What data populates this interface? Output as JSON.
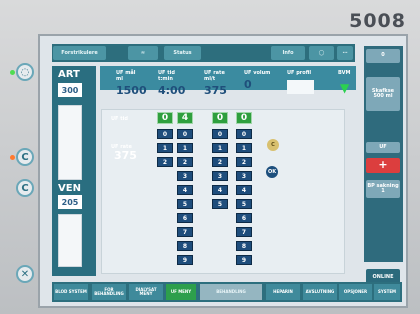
{
  "brand": "5008",
  "topbar": {
    "forstrikulere": "Forstrikulere",
    "status": "Status",
    "info": "Info"
  },
  "left_panel": {
    "art": "ART",
    "art_value": "300",
    "ven": "VEN",
    "ven_value": "205"
  },
  "main_fields": {
    "uf_mal_label": "UF mål",
    "uf_mal_unit": "ml",
    "uf_mal_value": "1500",
    "uf_tid_label": "UF tid",
    "uf_tid_unit": "t:min",
    "uf_tid_value": "4:00",
    "uf_rate_label": "UF rate",
    "uf_rate_unit": "ml/t",
    "uf_rate_value": "375",
    "uf_volum_label": "UF volum",
    "uf_volum_value": "0",
    "uf_profil_label": "UF profil",
    "bvm_label": "BVM"
  },
  "selector": {
    "uf_tid_label": "UF tid",
    "uf_rate_label": "UF rate",
    "uf_rate_value": "375",
    "top_values": [
      "0",
      "4",
      "0",
      "0"
    ],
    "col1": [
      "0",
      "1",
      "2"
    ],
    "col2": [
      "0",
      "1",
      "2",
      "3",
      "4",
      "5",
      "6",
      "7",
      "8",
      "9"
    ],
    "col3": [
      "0",
      "1",
      "2",
      "3",
      "4",
      "5"
    ],
    "col4": [
      "0",
      "1",
      "2",
      "3",
      "4",
      "5",
      "6",
      "7",
      "8",
      "9"
    ],
    "c_button": "C",
    "ok_button": "OK"
  },
  "right_panel": {
    "top_label": "0",
    "shuffle_label": "Skafkse 500 ml",
    "uf_label": "UF",
    "plus_label": "+",
    "bp_label": "BP sakning 1"
  },
  "bottom_buttons": [
    "BLOD SYSTEM",
    "FOR BEHANDLING",
    "DIALYSAT MENY",
    "UF MENY",
    "BEHANDLING",
    "HEPARIN",
    "AVSLUTNING",
    "OPSJONER",
    "SYSTEM"
  ],
  "right_bottom": {
    "online": "ONLINE"
  }
}
